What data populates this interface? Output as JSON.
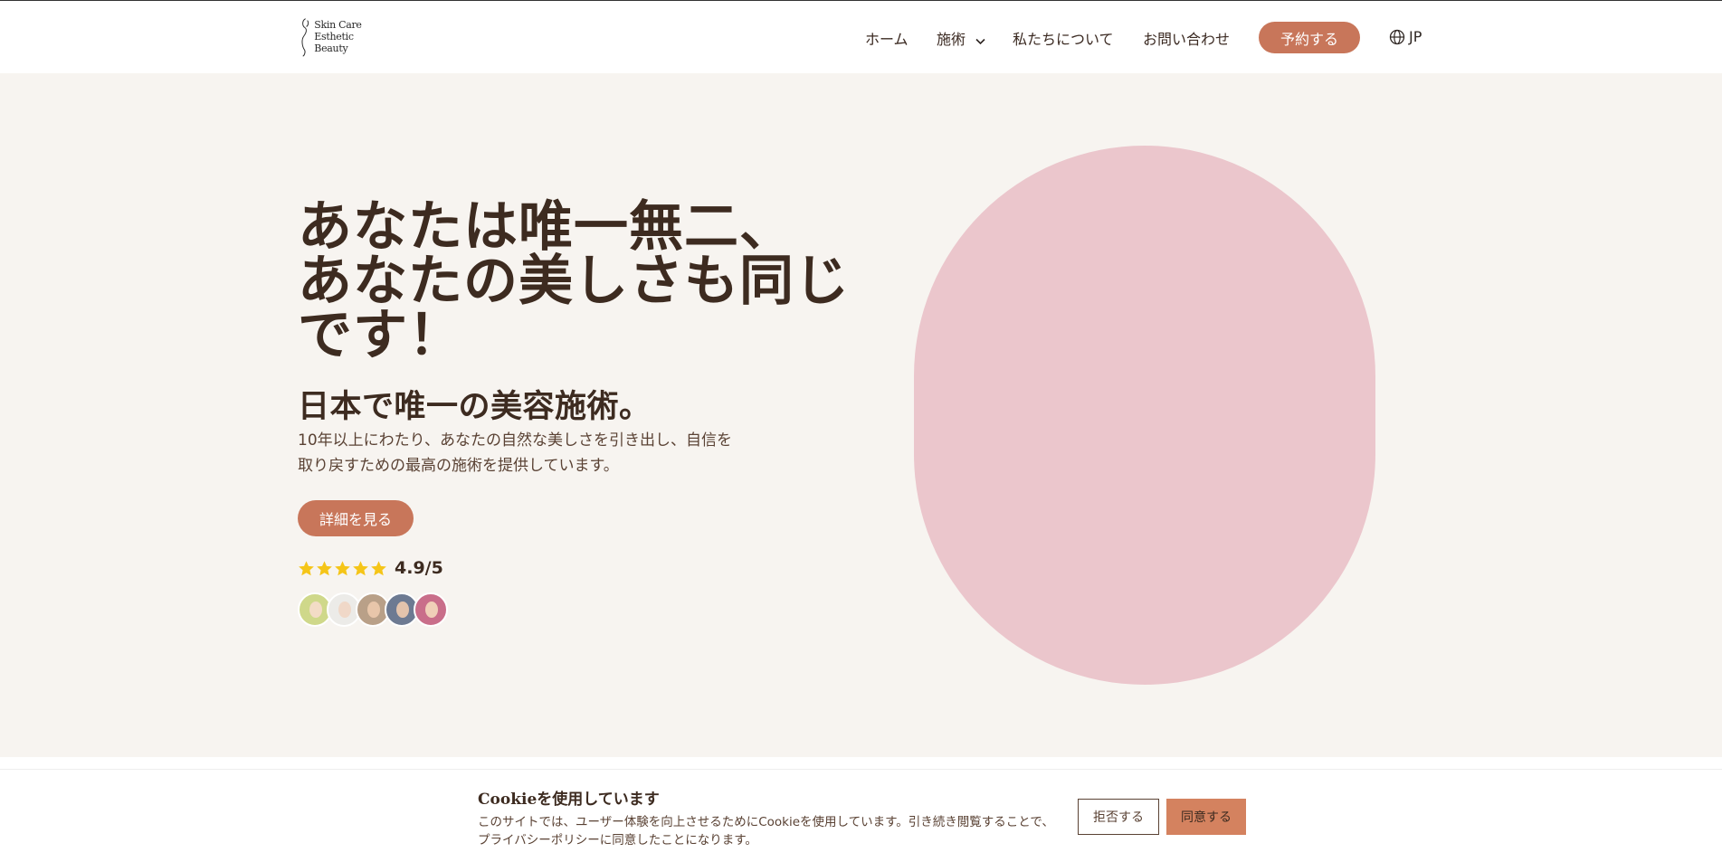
{
  "brand": {
    "logo_line1": "Skin Care",
    "logo_line2": "Esthetic Beauty"
  },
  "nav": {
    "items": [
      {
        "label": "ホーム"
      },
      {
        "label": "施術"
      },
      {
        "label": "私たちについて"
      },
      {
        "label": "お問い合わせ"
      }
    ],
    "book_label": "予約する",
    "lang_label": "JP",
    "icons": [
      "chevron-down-icon",
      "globe-icon"
    ]
  },
  "hero": {
    "title_line1": "あなたは唯一無二、",
    "title_line2": "あなたの美しさも同じ",
    "title_line3": "です！",
    "subtitle": "日本で唯一の美容施術。",
    "desc_line1": "10年以上にわたり、あなたの自然な美しさを引き出し、自信を",
    "desc_line2": "取り戻すための最高の施術を提供しています。",
    "detail_button": "詳細を見る",
    "rating": {
      "value_text": "4.9/5",
      "stars": 5
    },
    "avatar_count": 5,
    "colors": {
      "title": "#3d2b20",
      "accent": "#c8765a",
      "pill": "#ebc6cc",
      "background": "#f7f4f0",
      "star": "#f5c518"
    }
  },
  "cookie": {
    "title": "Cookieを使用しています",
    "text_line1": "このサイトでは、ユーザー体験を向上させるためにCookieを使用しています。引き続き閲覧することで、",
    "text_line2": "プライバシーポリシーに同意したことになります。",
    "decline_label": "拒否する",
    "accept_label": "同意する"
  }
}
